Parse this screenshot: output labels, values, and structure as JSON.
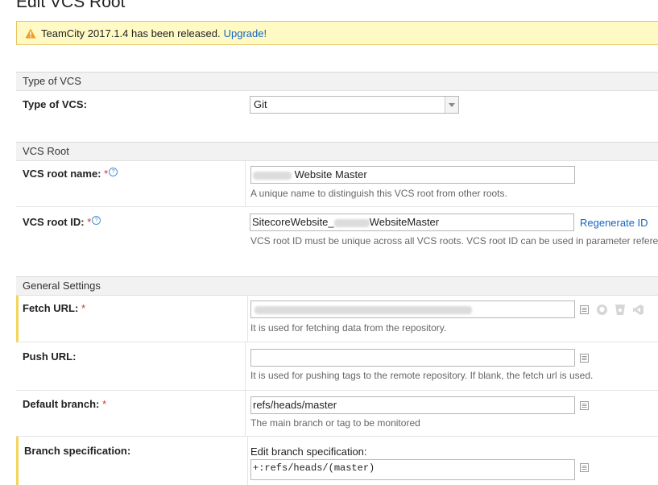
{
  "page": {
    "title": "Edit VCS Root"
  },
  "banner": {
    "message": "TeamCity 2017.1.4 has been released.",
    "link": "Upgrade!"
  },
  "sections": {
    "type_of_vcs": "Type of VCS",
    "vcs_root": "VCS Root",
    "general_settings": "General Settings"
  },
  "fields": {
    "type_of_vcs": {
      "label": "Type of VCS:",
      "value": "Git"
    },
    "vcs_root_name": {
      "label": "VCS root name:",
      "required": "*",
      "value": "Website Master",
      "note": "A unique name to distinguish this VCS root from other roots."
    },
    "vcs_root_id": {
      "label": "VCS root ID:",
      "required": "*",
      "value_prefix": "SitecoreWebsite_",
      "value_suffix": "WebsiteMaster",
      "action": "Regenerate ID",
      "note": "VCS root ID must be unique across all VCS roots. VCS root ID can be used in parameter referenc"
    },
    "fetch_url": {
      "label": "Fetch URL:",
      "required": "*",
      "note": "It is used for fetching data from the repository."
    },
    "push_url": {
      "label": "Push URL:",
      "value": "",
      "note": "It is used for pushing tags to the remote repository. If blank, the fetch url is used."
    },
    "default_branch": {
      "label": "Default branch:",
      "required": "*",
      "value": "refs/heads/master",
      "note": "The main branch or tag to be monitored"
    },
    "branch_spec": {
      "label": "Branch specification:",
      "caption": "Edit branch specification:",
      "value": "+:refs/heads/(master)"
    }
  },
  "icons": {
    "help": "help-circle-icon",
    "field_menu": "list-icon",
    "github": "github-icon",
    "bitbucket": "bitbucket-icon",
    "vsts": "visual-studio-icon"
  },
  "colors": {
    "banner_bg": "#fff9c4",
    "link": "#1565c0",
    "required": "#d32f2f",
    "highlight_bar": "#f2d55c"
  }
}
